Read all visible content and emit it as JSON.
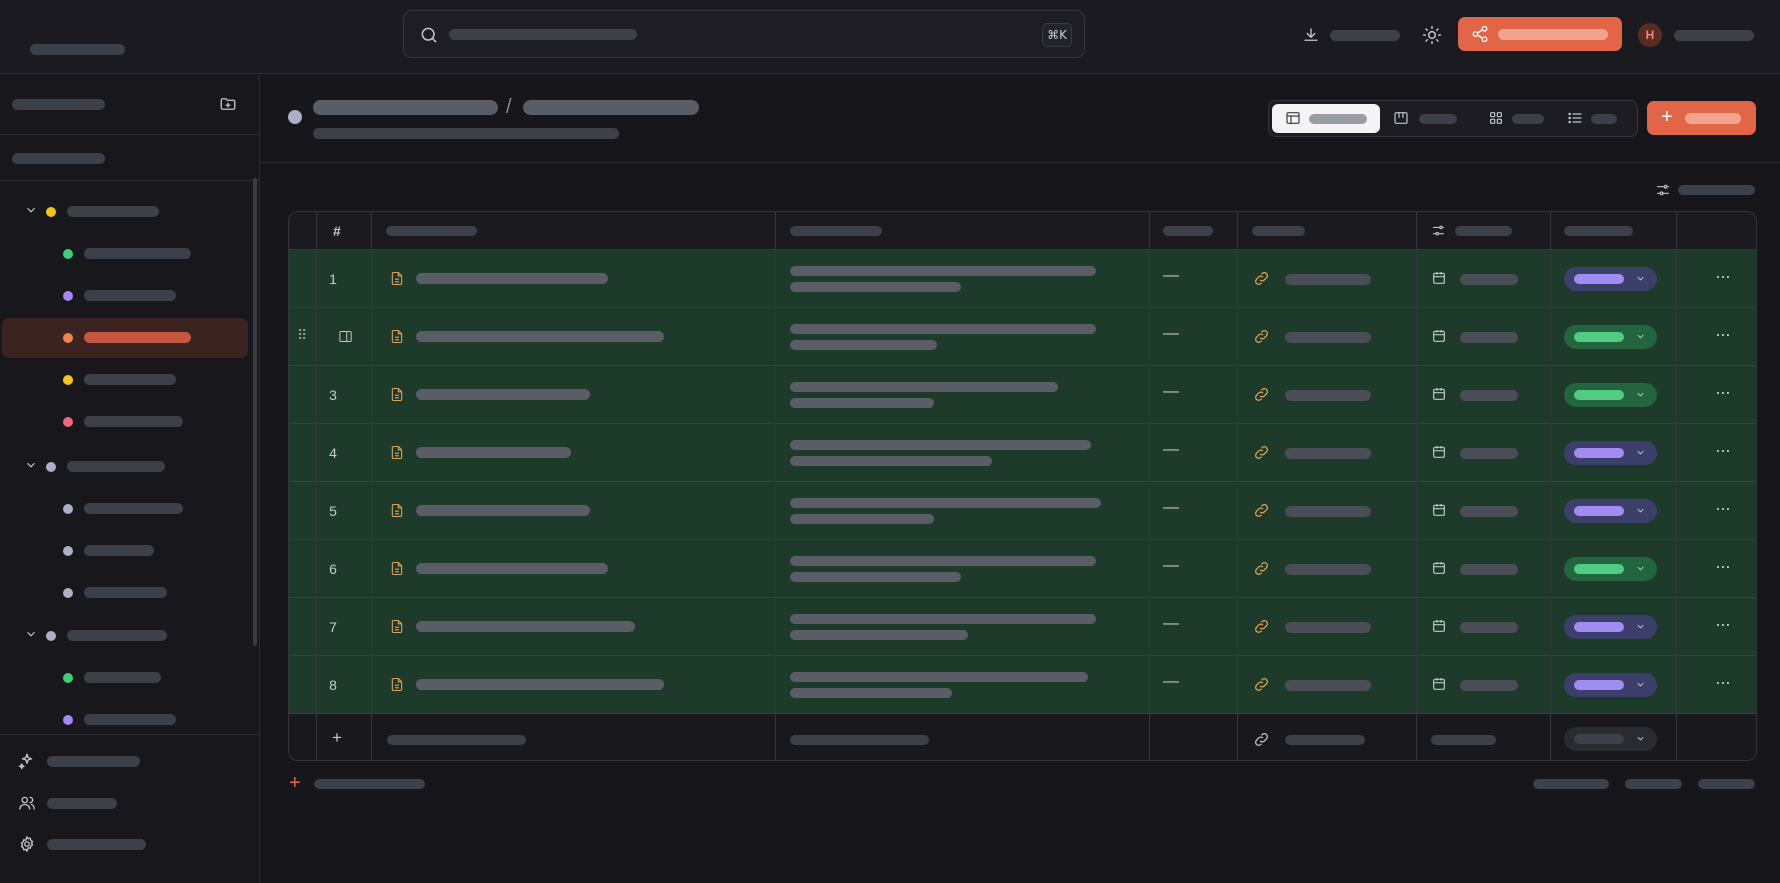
{
  "topbar": {
    "search_shortcut": "⌘K",
    "avatar_initial": "H",
    "icons": [
      "search-icon",
      "download-icon",
      "sun-icon",
      "share-icon"
    ]
  },
  "sidebar": {
    "icons": [
      "new-folder-icon",
      "chevron-down-icon",
      "sparkles-icon",
      "users-icon",
      "gear-icon"
    ],
    "tree": [
      {
        "level": 0,
        "dot": "#f5c518"
      },
      {
        "level": 1,
        "dot": "#3fcf7c"
      },
      {
        "level": 1,
        "dot": "#a886f7"
      },
      {
        "level": 1,
        "dot": "#f08550",
        "active": true
      },
      {
        "level": 1,
        "dot": "#f5c518"
      },
      {
        "level": 1,
        "dot": "#f0667a"
      },
      {
        "level": 0,
        "dot": "#a8b1c8"
      },
      {
        "level": 1,
        "dot": "#a8b1c8"
      },
      {
        "level": 1,
        "dot": "#a8b1c8"
      },
      {
        "level": 1,
        "dot": "#a8b1c8"
      },
      {
        "level": 0,
        "dot": "#a8b1c8"
      },
      {
        "level": 1,
        "dot": "#3fcf7c"
      },
      {
        "level": 1,
        "dot": "#a886f7"
      }
    ]
  },
  "header": {
    "breadcrumb_separator": "/",
    "views": [
      "table-view",
      "board-view",
      "gallery-view",
      "list-view"
    ],
    "active_view": "table-view",
    "new_button_icon": "+"
  },
  "table": {
    "header_hash": "#",
    "dash": "—",
    "rows": [
      {
        "num": "1",
        "status": "purple"
      },
      {
        "num": "",
        "status": "green",
        "hovered": true
      },
      {
        "num": "3",
        "status": "green"
      },
      {
        "num": "4",
        "status": "purple"
      },
      {
        "num": "5",
        "status": "purple"
      },
      {
        "num": "6",
        "status": "green"
      },
      {
        "num": "7",
        "status": "purple"
      },
      {
        "num": "8",
        "status": "purple"
      }
    ],
    "add_symbol": "+",
    "more_symbol": "···"
  },
  "colors": {
    "accent": "#e26548",
    "row_highlight": "#1d3a2b",
    "status_purple": "#a18cf2",
    "status_green": "#52cc85",
    "icon_amber": "#e0a458"
  }
}
